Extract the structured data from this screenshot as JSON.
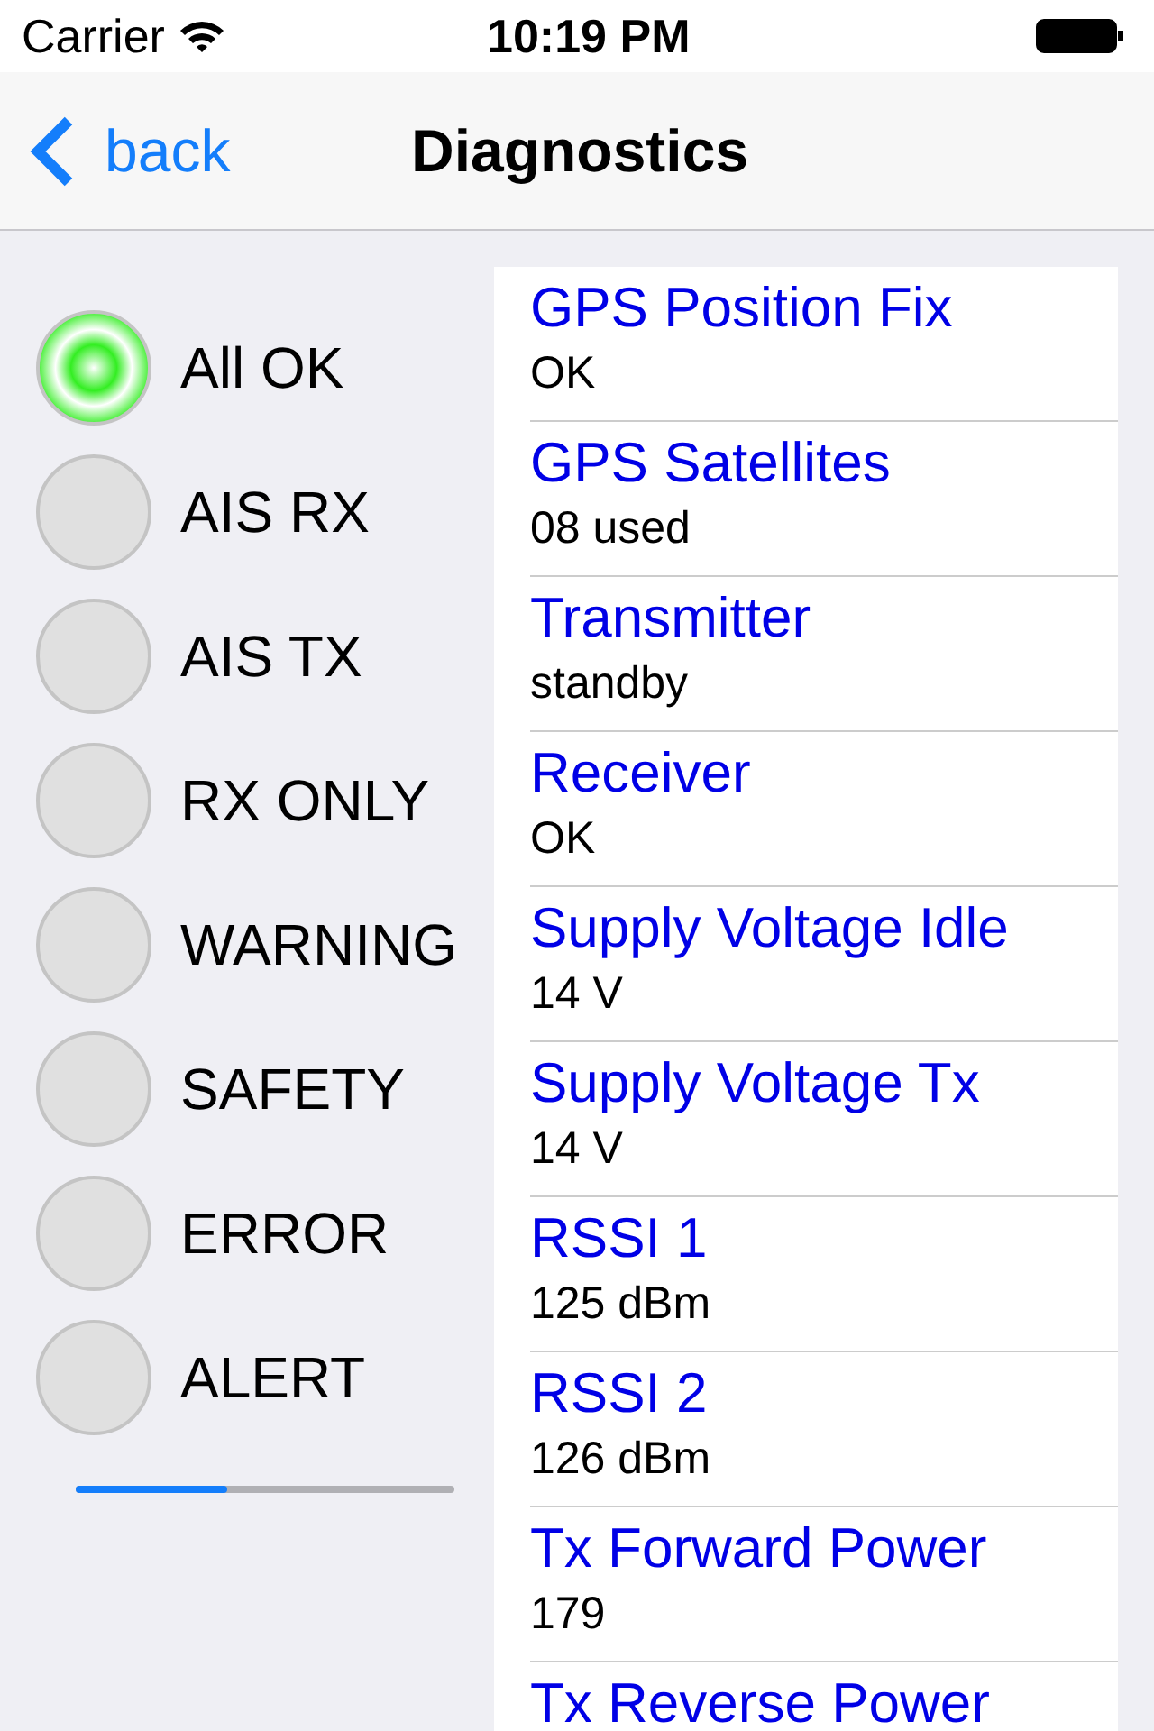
{
  "status_bar": {
    "carrier": "Carrier",
    "time": "10:19 PM"
  },
  "nav": {
    "back": "back",
    "title": "Diagnostics"
  },
  "indicators": [
    {
      "label": "All OK",
      "on": true,
      "color": "#33ee22"
    },
    {
      "label": "AIS RX",
      "on": false
    },
    {
      "label": "AIS TX",
      "on": false
    },
    {
      "label": "RX ONLY",
      "on": false
    },
    {
      "label": "WARNING",
      "on": false
    },
    {
      "label": "SAFETY",
      "on": false
    },
    {
      "label": "ERROR",
      "on": false
    },
    {
      "label": "ALERT",
      "on": false
    }
  ],
  "progress": {
    "level": 0.4
  },
  "items": [
    {
      "title": "GPS Position Fix",
      "value": "OK"
    },
    {
      "title": "GPS Satellites",
      "value": "08 used"
    },
    {
      "title": "Transmitter",
      "value": "standby"
    },
    {
      "title": "Receiver",
      "value": "OK"
    },
    {
      "title": "Supply Voltage Idle",
      "value": "14 V"
    },
    {
      "title": "Supply Voltage Tx",
      "value": "14 V"
    },
    {
      "title": "RSSI 1",
      "value": "125 dBm"
    },
    {
      "title": "RSSI 2",
      "value": "126 dBm"
    },
    {
      "title": "Tx Forward Power",
      "value": "179"
    },
    {
      "title": "Tx Reverse Power"
    }
  ]
}
